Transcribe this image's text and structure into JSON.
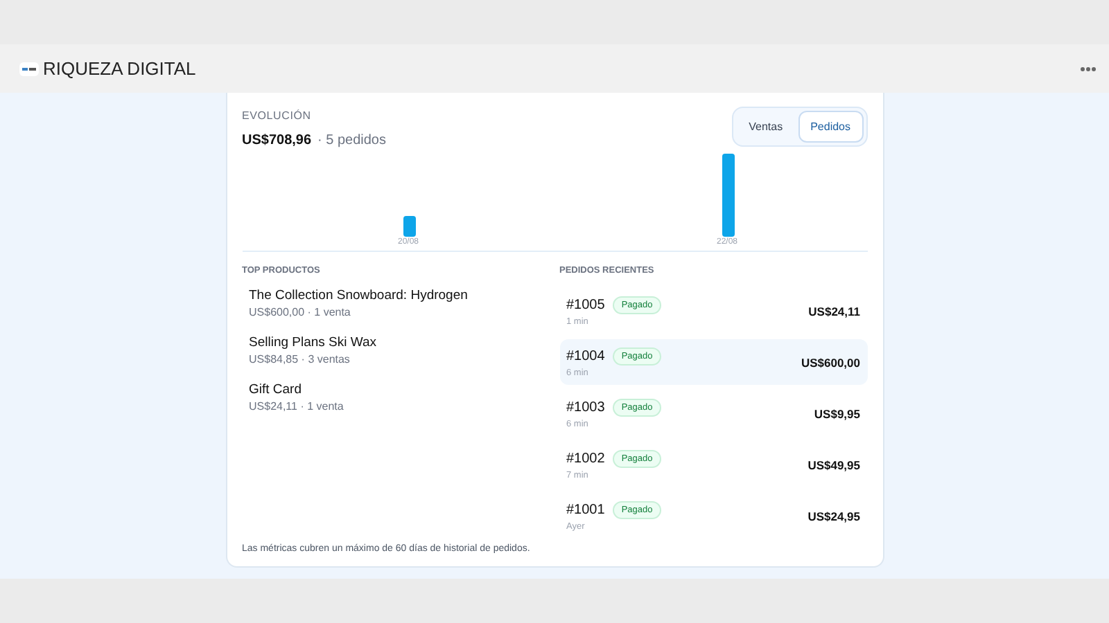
{
  "header": {
    "title": "RIQUEZA DIGITAL"
  },
  "evolution": {
    "label": "EVOLUCIÓN",
    "total": "US$708,96",
    "orders": "· 5 pedidos",
    "toggle": [
      {
        "label": "Ventas",
        "selected": false
      },
      {
        "label": "Pedidos",
        "selected": true
      }
    ],
    "chart_dates": [
      "20/08",
      "22/08"
    ]
  },
  "top_products": {
    "title": "TOP PRODUCTOS",
    "items": [
      {
        "name": "The Collection Snowboard: Hydrogen",
        "detail": "US$600,00 · 1 venta"
      },
      {
        "name": "Selling Plans Ski Wax",
        "detail": "US$84,85 · 3 ventas"
      },
      {
        "name": "Gift Card",
        "detail": "US$24,11 · 1 venta"
      }
    ]
  },
  "recent_orders": {
    "title": "PEDIDOS RECIENTES",
    "items": [
      {
        "number": "#1005",
        "status": "Pagado",
        "time": "1 min",
        "amount": "US$24,11",
        "selected": false
      },
      {
        "number": "#1004",
        "status": "Pagado",
        "time": "6 min",
        "amount": "US$600,00",
        "selected": true
      },
      {
        "number": "#1003",
        "status": "Pagado",
        "time": "6 min",
        "amount": "US$9,95",
        "selected": false
      },
      {
        "number": "#1002",
        "status": "Pagado",
        "time": "7 min",
        "amount": "US$49,95",
        "selected": false
      },
      {
        "number": "#1001",
        "status": "Pagado",
        "time": "Ayer",
        "amount": "US$24,95",
        "selected": false
      }
    ]
  },
  "footnote": "Las métricas cubren un máximo de 60 días de historial de pedidos."
}
